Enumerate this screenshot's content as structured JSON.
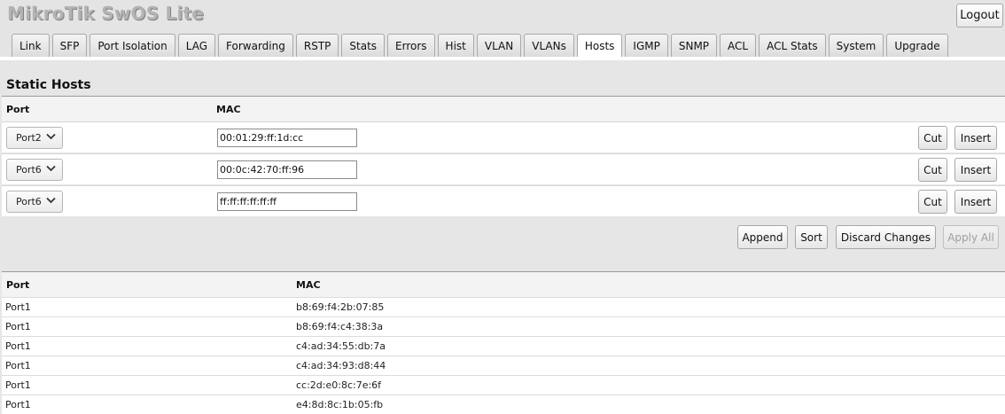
{
  "app": {
    "title": "MikroTik SwOS Lite",
    "logout_label": "Logout"
  },
  "tabs": [
    {
      "label": "Link",
      "active": false
    },
    {
      "label": "SFP",
      "active": false
    },
    {
      "label": "Port Isolation",
      "active": false
    },
    {
      "label": "LAG",
      "active": false
    },
    {
      "label": "Forwarding",
      "active": false
    },
    {
      "label": "RSTP",
      "active": false
    },
    {
      "label": "Stats",
      "active": false
    },
    {
      "label": "Errors",
      "active": false
    },
    {
      "label": "Hist",
      "active": false
    },
    {
      "label": "VLAN",
      "active": false
    },
    {
      "label": "VLANs",
      "active": false
    },
    {
      "label": "Hosts",
      "active": true
    },
    {
      "label": "IGMP",
      "active": false
    },
    {
      "label": "SNMP",
      "active": false
    },
    {
      "label": "ACL",
      "active": false
    },
    {
      "label": "ACL Stats",
      "active": false
    },
    {
      "label": "System",
      "active": false
    },
    {
      "label": "Upgrade",
      "active": false
    }
  ],
  "static_hosts": {
    "title": "Static Hosts",
    "columns": {
      "port": "Port",
      "mac": "MAC"
    },
    "rows": [
      {
        "port": "Port2",
        "mac": "00:01:29:ff:1d:cc"
      },
      {
        "port": "Port6",
        "mac": "00:0c:42:70:ff:96"
      },
      {
        "port": "Port6",
        "mac": "ff:ff:ff:ff:ff:ff"
      }
    ],
    "row_buttons": {
      "cut": "Cut",
      "insert": "Insert"
    },
    "actions": {
      "append": "Append",
      "sort": "Sort",
      "discard": "Discard Changes",
      "apply": "Apply All"
    }
  },
  "dynamic_hosts": {
    "columns": {
      "port": "Port",
      "mac": "MAC"
    },
    "rows": [
      {
        "port": "Port1",
        "mac": "b8:69:f4:2b:07:85"
      },
      {
        "port": "Port1",
        "mac": "b8:69:f4:c4:38:3a"
      },
      {
        "port": "Port1",
        "mac": "c4:ad:34:55:db:7a"
      },
      {
        "port": "Port1",
        "mac": "c4:ad:34:93:d8:44"
      },
      {
        "port": "Port1",
        "mac": "cc:2d:e0:8c:7e:6f"
      },
      {
        "port": "Port1",
        "mac": "e4:8d:8c:1b:05:fb"
      }
    ]
  },
  "icons": {
    "select_arrow": "chevron-down-icon"
  }
}
